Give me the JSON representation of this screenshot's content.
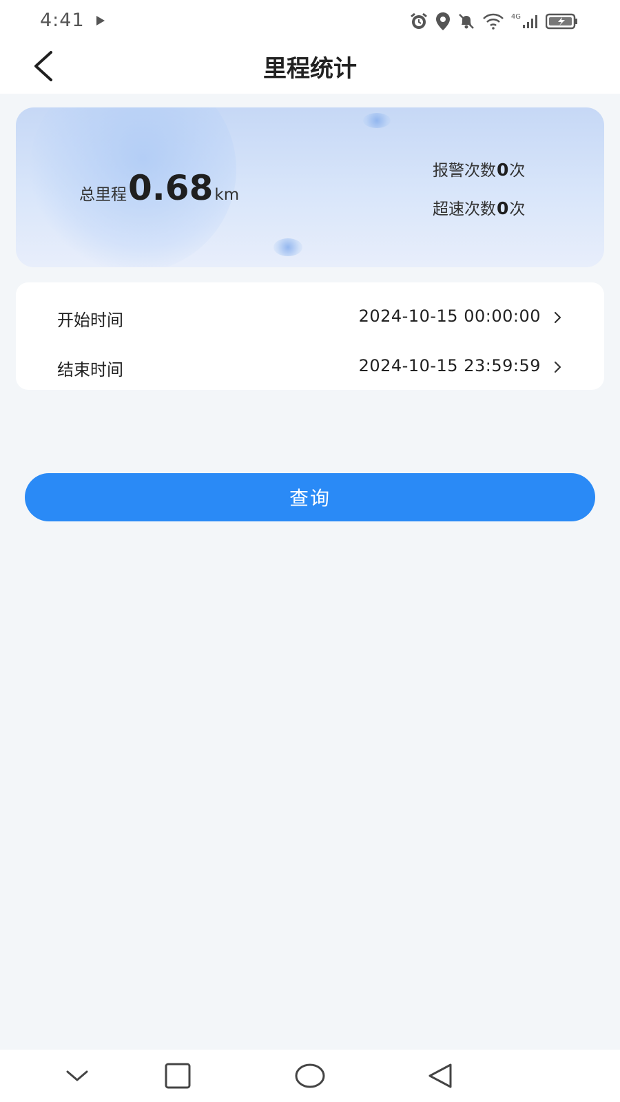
{
  "status_bar": {
    "time": "4:41",
    "network": "4G"
  },
  "header": {
    "title": "里程统计"
  },
  "summary": {
    "mileage_label": "总里程",
    "mileage_value": "0.68",
    "mileage_unit": "km",
    "alarm_prefix": "报警次数",
    "alarm_count": "0",
    "alarm_suffix": "次",
    "overspeed_prefix": "超速次数",
    "overspeed_count": "0",
    "overspeed_suffix": "次"
  },
  "time_range": {
    "start_label": "开始时间",
    "start_value": "2024-10-15 00:00:00",
    "end_label": "结束时间",
    "end_value": "2024-10-15 23:59:59"
  },
  "query_button": {
    "label": "查询"
  },
  "colors": {
    "accent": "#2a8af6",
    "background": "#f3f6f9"
  }
}
